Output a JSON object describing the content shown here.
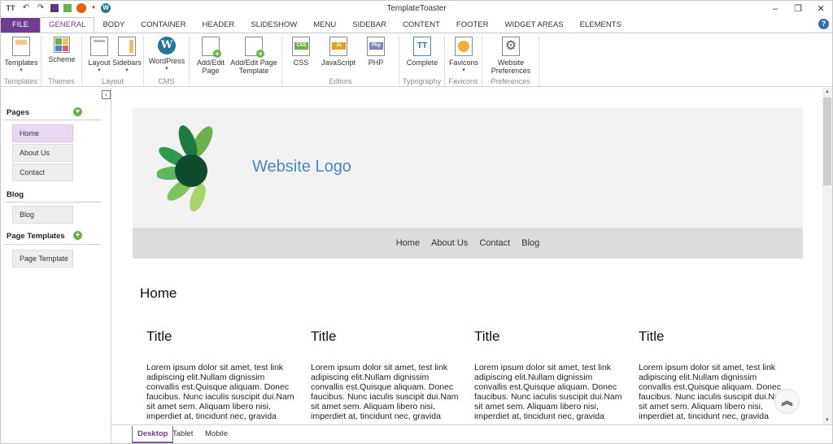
{
  "app": {
    "title": "TemplateToaster"
  },
  "window_controls": [
    "–",
    "❐",
    "✕"
  ],
  "tabs": [
    "FILE",
    "GENERAL",
    "BODY",
    "CONTAINER",
    "HEADER",
    "SLIDESHOW",
    "MENU",
    "SIDEBAR",
    "CONTENT",
    "FOOTER",
    "WIDGET AREAS",
    "ELEMENTS"
  ],
  "ribbon": {
    "templates": {
      "btn": "Templates",
      "group": "Templates"
    },
    "themes": {
      "btn": "Scheme",
      "group": "Themes"
    },
    "layout": {
      "btn1": "Layout",
      "btn2": "Sidebars",
      "group": "Layout"
    },
    "cms": {
      "btn": "WordPress",
      "group": "CMS"
    },
    "pages": {
      "btn1a": "Add/Edit",
      "btn1b": "Page",
      "btn2a": "Add/Edit Page",
      "btn2b": "Template"
    },
    "editors": {
      "css": "CSS",
      "js": "JavaScript",
      "php": "PHP",
      "group": "Editors",
      "css_badge": "CSS",
      "js_badge": "Js",
      "php_badge": "Php"
    },
    "typography": {
      "btn": "Complete",
      "group": "Typography",
      "icon_text": "TT"
    },
    "favicons": {
      "btn": "Favicons",
      "group": "Favicons"
    },
    "preferences": {
      "btn1": "Website",
      "btn2": "Preferences",
      "group": "Preferences"
    }
  },
  "sidebar": {
    "pages_label": "Pages",
    "pages": [
      "Home",
      "About Us",
      "Contact"
    ],
    "blog_label": "Blog",
    "blog_items": [
      "Blog"
    ],
    "templates_label": "Page Templates",
    "template_items": [
      "Page Template"
    ]
  },
  "preview": {
    "logo_text": "Website Logo",
    "nav": [
      "Home",
      "About Us",
      "Contact",
      "Blog"
    ],
    "page_heading": "Home",
    "columns": [
      {
        "title": "Title",
        "body": "Lorem ipsum dolor sit amet, test link adipiscing elit.Nullam dignissim convallis est.Quisque aliquam. Donec faucibus. Nunc iaculis suscipit dui.Nam sit amet sem. Aliquam libero nisi, imperdiet at, tincidunt nec, gravida"
      },
      {
        "title": "Title",
        "body": "Lorem ipsum dolor sit amet, test link adipiscing elit.Nullam dignissim convallis est.Quisque aliquam. Donec faucibus. Nunc iaculis suscipit dui.Nam sit amet sem. Aliquam libero nisi, imperdiet at, tincidunt nec, gravida"
      },
      {
        "title": "Title",
        "body": "Lorem ipsum dolor sit amet, test link adipiscing elit.Nullam dignissim convallis est.Quisque aliquam. Donec faucibus. Nunc iaculis suscipit dui.Nam sit amet sem. Aliquam libero nisi, imperdiet at, tincidunt nec, gravida"
      },
      {
        "title": "Title",
        "body": "Lorem ipsum dolor sit amet, test link adipiscing elit.Nullam dignissim convallis est.Quisque aliquam. Donec faucibus. Nunc iaculis suscipit dui.Nam sit amet sem. Aliquam libero nisi, imperdiet at, tincidunt nec, gravida"
      }
    ]
  },
  "view_tabs": [
    "Desktop",
    "Tablet",
    "Mobile"
  ],
  "colors": {
    "accent": "#6f3c8f",
    "logo_text": "#4a86c5",
    "add": "#6ab04c"
  }
}
